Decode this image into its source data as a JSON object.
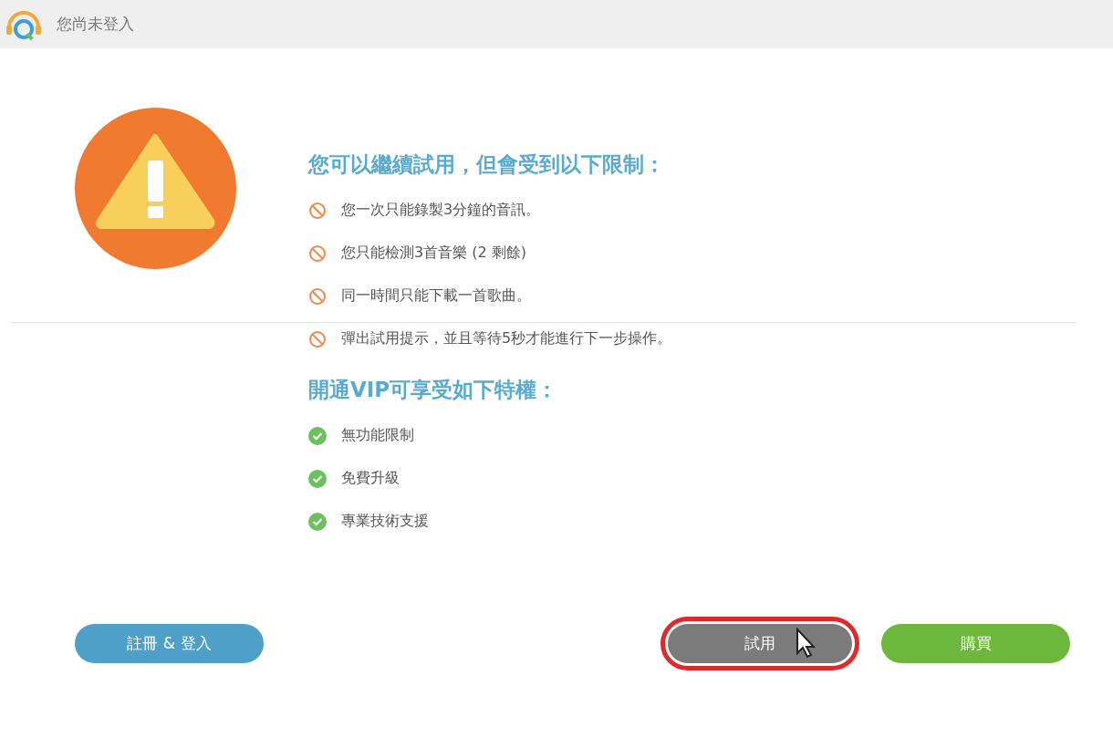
{
  "window": {
    "title": "您尚未登入"
  },
  "limits": {
    "heading": "您可以繼續試用，但會受到以下限制：",
    "items": [
      {
        "text": "您一次只能錄製3分鐘的音訊。"
      },
      {
        "text": "您只能檢測3首音樂 (2 剩餘)"
      },
      {
        "text": "同一時間只能下載一首歌曲。"
      },
      {
        "text": "彈出試用提示，並且等待5秒才能進行下一步操作。"
      }
    ]
  },
  "vip": {
    "heading": "開通VIP可享受如下特權：",
    "items": [
      {
        "text": "無功能限制"
      },
      {
        "text": "免費升級"
      },
      {
        "text": "專業技術支援"
      }
    ]
  },
  "buttons": [
    {
      "label": "註冊 & 登入",
      "kind": "register",
      "highlighted": false
    },
    {
      "label": "試用",
      "kind": "trial",
      "highlighted": true
    },
    {
      "label": "購買",
      "kind": "buy",
      "highlighted": false
    }
  ]
}
